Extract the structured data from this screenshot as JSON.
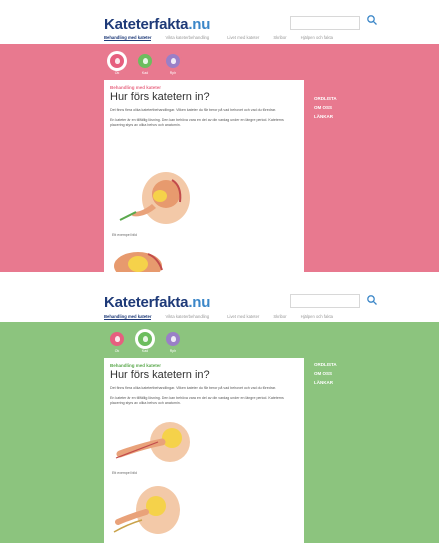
{
  "brand": {
    "name_main": "Kateterfakta",
    "name_tld": ".nu"
  },
  "nav": [
    "Behandling med kateter",
    "Vikta kateterbehandling",
    "Livet med kateter",
    "Skribor",
    "Hjälpen och fakta"
  ],
  "tabs": [
    {
      "label": "Ok",
      "color": "#e65f7f"
    },
    {
      "label": "Kad",
      "color": "#6cbd5e"
    },
    {
      "label": "Rph",
      "color": "#9a7fc7"
    }
  ],
  "article": {
    "breadcrumb": "Behandling med kateter",
    "title": "Hur förs katetern in?",
    "paragraph1": "Det finns flera olika katetertbehandlingar. Vilken kateter du får beror på vad behovet och vad du föredrar.",
    "paragraph2": "En kateter är en tillfällig lösning. Den kan behöva vara en del av din vardag under en längre period. Kateterns placering styrs av olika behov och anatomin.",
    "caption": "Ett exempel bild"
  },
  "sidebar": [
    "ORDLISTA",
    "OM OSS",
    "LÄNKAR"
  ],
  "variants": [
    {
      "band_color": "#e8798f",
      "breadcrumb_color": "#e86a84",
      "active_tab": 0
    },
    {
      "band_color": "#8cc47e",
      "breadcrumb_color": "#5aa84c",
      "active_tab": 1
    }
  ]
}
